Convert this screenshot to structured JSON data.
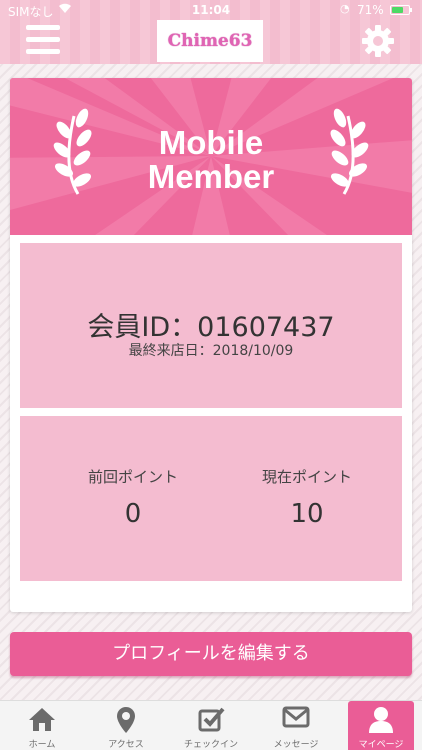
{
  "status_bar": {
    "carrier": "SIMなし",
    "time": "11:04",
    "battery": "71%",
    "battery_level": 0.71
  },
  "header": {
    "logo_text": "Chime63"
  },
  "banner": {
    "title_line1": "Mobile",
    "title_line2": "Member"
  },
  "member": {
    "id_label": "会員ID：",
    "id_value": "01607437",
    "last_visit_label": "最終来店日：",
    "last_visit_value": "2018/10/09"
  },
  "points": {
    "previous_label": "前回ポイント",
    "previous_value": "0",
    "current_label": "現在ポイント",
    "current_value": "10"
  },
  "profile_button": "プロフィールを編集する",
  "tabs": [
    {
      "label": "ホーム",
      "icon": "home-icon",
      "active": false
    },
    {
      "label": "アクセス",
      "icon": "map-pin-icon",
      "active": false
    },
    {
      "label": "チェックイン",
      "icon": "checkin-icon",
      "active": false
    },
    {
      "label": "メッセージ",
      "icon": "mail-icon",
      "active": false
    },
    {
      "label": "マイページ",
      "icon": "user-icon",
      "active": true
    }
  ],
  "colors": {
    "accent": "#ea5d96",
    "banner": "#ee6a9c",
    "panel": "#f4bcd0",
    "header": "#f6c7d6"
  }
}
